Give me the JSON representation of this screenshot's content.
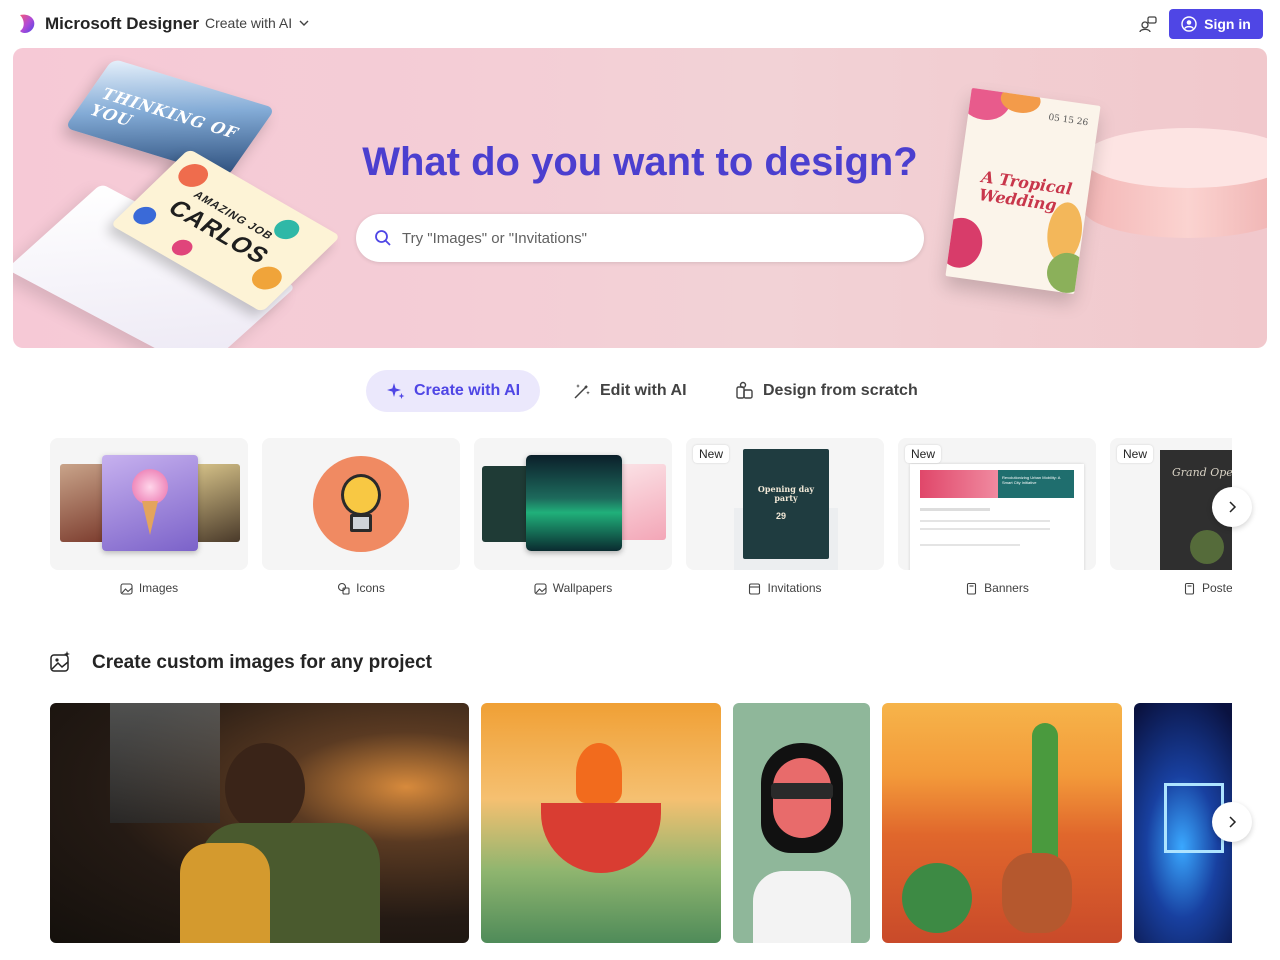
{
  "header": {
    "brand": "Microsoft Designer",
    "create_menu": "Create with AI",
    "sign_in": "Sign in"
  },
  "hero": {
    "title": "What do you want to design?",
    "search_placeholder": "Try \"Images\" or \"Invitations\"",
    "card_thinking": "THINKING OF YOU",
    "card_carlos_line1": "AMAZING JOB",
    "card_carlos_line2": "CARLOS",
    "invite_title": "A Tropical Wedding",
    "invite_date": "05 15 26"
  },
  "modes": [
    {
      "label": "Create with AI",
      "active": true
    },
    {
      "label": "Edit with AI",
      "active": false
    },
    {
      "label": "Design from scratch",
      "active": false
    }
  ],
  "categories": [
    {
      "label": "Images",
      "badge": "",
      "icon": "image-sparkle-icon"
    },
    {
      "label": "Icons",
      "badge": "",
      "icon": "shapes-icon"
    },
    {
      "label": "Wallpapers",
      "badge": "",
      "icon": "image-sparkle-icon"
    },
    {
      "label": "Invitations",
      "badge": "New",
      "icon": "calendar-icon"
    },
    {
      "label": "Banners",
      "badge": "New",
      "icon": "document-icon"
    },
    {
      "label": "Poster",
      "badge": "New",
      "icon": "document-icon"
    }
  ],
  "invitation_thumb": {
    "title": "Opening day party",
    "day": "29"
  },
  "banner_thumb": {
    "text": "Revolutionizing Urban Mobility: A Smart City Initiative"
  },
  "poster_thumb": {
    "text": "Grand Opening"
  },
  "section": {
    "title": "Create custom images for any project",
    "icon": "image-sparkle-icon"
  },
  "colors": {
    "accent": "#4f46e5",
    "hero_title": "#4b3fcf",
    "active_tab_bg": "#ebe8fc"
  }
}
